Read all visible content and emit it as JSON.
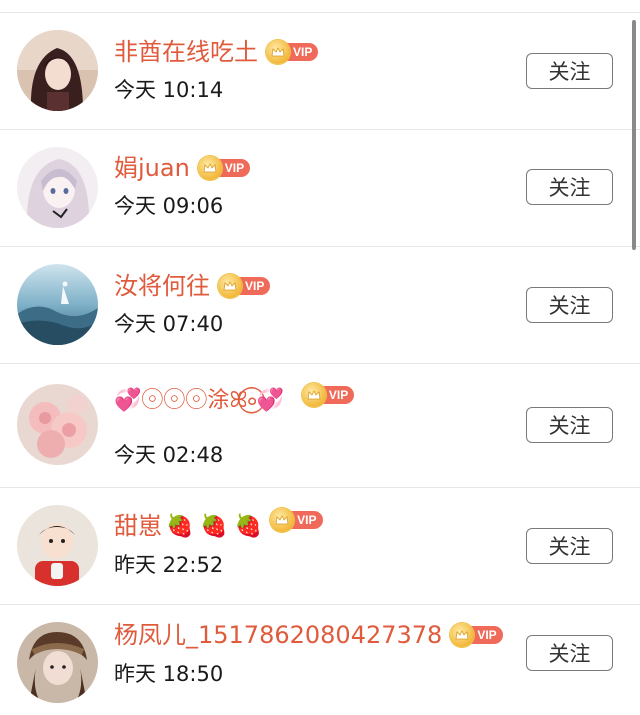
{
  "rows": [
    {
      "name": "非酋在线吃土",
      "emoji": "",
      "time": "今天 10:14",
      "vip": "VIP",
      "button": "关注",
      "avatar_color": "#5a3a3a"
    },
    {
      "name": "娟juan",
      "emoji": "",
      "time": "今天 09:06",
      "vip": "VIP",
      "button": "关注",
      "avatar_color": "#e8dde6"
    },
    {
      "name": "汝将何往",
      "emoji": "",
      "time": "今天 07:40",
      "vip": "VIP",
      "button": "关注",
      "avatar_color": "#4a7a92"
    },
    {
      "name": "💞◦⃝◦⃝◦⃝涂ꕤ◦⃝💞",
      "emoji": "",
      "time": "今天 02:48",
      "vip": "VIP",
      "button": "关注",
      "avatar_color": "#f2c6c4"
    },
    {
      "name": "甜崽",
      "emoji": "🍓 🍓 🍓",
      "time": "昨天 22:52",
      "vip": "VIP",
      "button": "关注",
      "avatar_color": "#d9c9b8"
    },
    {
      "name": "杨凤儿_1517862080427378",
      "emoji": "",
      "time": "昨天 18:50",
      "vip": "VIP",
      "button": "关注",
      "avatar_color": "#6b4a3a"
    }
  ]
}
